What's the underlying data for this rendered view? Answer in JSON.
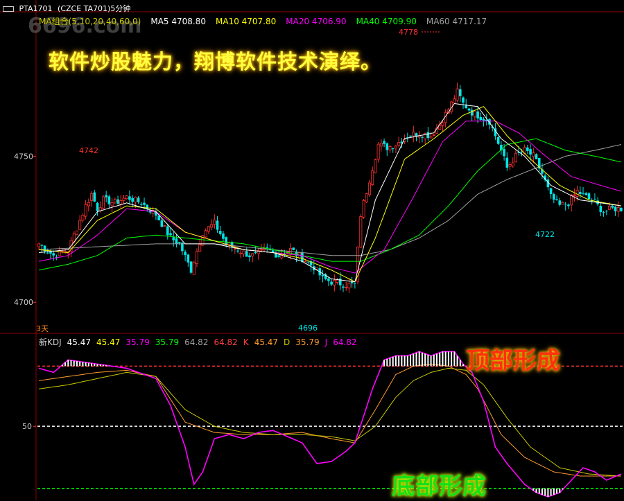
{
  "header": {
    "icon": "window-icon",
    "symbol": "PTA1701",
    "code": "(CZCE TA701)5分钟"
  },
  "watermark": "6696.com",
  "promo_text": "软件炒股魅力，翔博软件技术演绎。",
  "ma_legend": [
    {
      "label": "MA组合(5,10,20,40,60,0)",
      "color": "#c8c800"
    },
    {
      "label": "MA5 4708.80",
      "color": "#ffffff"
    },
    {
      "label": "MA10 4707.80",
      "color": "#ffff00"
    },
    {
      "label": "MA20 4706.90",
      "color": "#ff00ff"
    },
    {
      "label": "MA40 4709.90",
      "color": "#00ff00"
    },
    {
      "label": "MA60 4717.17",
      "color": "#a0a0a0"
    }
  ],
  "period_label": "3天",
  "kdj_legend": [
    {
      "label": "新KDJ",
      "color": "#cccccc"
    },
    {
      "label": "45.47",
      "color": "#ffffff"
    },
    {
      "label": "45.47",
      "color": "#ffff00"
    },
    {
      "label": "35.79",
      "color": "#ff00ff"
    },
    {
      "label": "35.79",
      "color": "#00ff00"
    },
    {
      "label": "64.82",
      "color": "#a0a0a0"
    },
    {
      "label": "64.82",
      "color": "#ff4040"
    },
    {
      "label": "K",
      "color": "#ff4040"
    },
    {
      "label": "45.47",
      "color": "#ff9a30"
    },
    {
      "label": "D",
      "color": "#c8c800"
    },
    {
      "label": "35.79",
      "color": "#ff9a30"
    },
    {
      "label": "J",
      "color": "#ff00ff"
    },
    {
      "label": "64.82",
      "color": "#ff00ff"
    }
  ],
  "annotations": {
    "top_formation": "顶部形成",
    "bottom_formation": "底部形成",
    "high_4742": "4742",
    "high_4778": "4778",
    "low_4696": "4696",
    "low_4722": "4722"
  },
  "chart_data": [
    {
      "type": "candlestick",
      "title": "PTA1701 (CZCE TA701)5分钟",
      "y_ticks": [
        4700,
        4750
      ],
      "ylim": [
        4689.6,
        4799.2
      ],
      "grid": false,
      "colors": {
        "up": "#ff3030",
        "down": "#00e5e5",
        "ma5": "#ffffff",
        "ma10": "#ffff00",
        "ma20": "#ff00ff",
        "ma40": "#00ff00",
        "ma60": "#a0a0a0"
      },
      "extremes": {
        "high": 4778,
        "low": 4696,
        "local_high": 4742,
        "local_low": 4722
      },
      "anchors": [
        [
          0,
          4720
        ],
        [
          5,
          4716
        ],
        [
          10,
          4718
        ],
        [
          14,
          4728
        ],
        [
          16,
          4733
        ],
        [
          18,
          4737
        ],
        [
          20,
          4732
        ],
        [
          22,
          4735
        ],
        [
          26,
          4734
        ],
        [
          30,
          4736
        ],
        [
          35,
          4734
        ],
        [
          40,
          4730
        ],
        [
          45,
          4722
        ],
        [
          48,
          4720
        ],
        [
          52,
          4711
        ],
        [
          56,
          4724
        ],
        [
          60,
          4727
        ],
        [
          64,
          4720
        ],
        [
          68,
          4718
        ],
        [
          72,
          4716
        ],
        [
          74,
          4716
        ],
        [
          78,
          4718
        ],
        [
          82,
          4716
        ],
        [
          86,
          4718
        ],
        [
          90,
          4715
        ],
        [
          94,
          4712
        ],
        [
          97,
          4708
        ],
        [
          100,
          4707
        ],
        [
          105,
          4706
        ],
        [
          108,
          4706
        ],
        [
          110,
          4730
        ],
        [
          113,
          4742
        ],
        [
          116,
          4754
        ],
        [
          119,
          4753
        ],
        [
          122,
          4754
        ],
        [
          126,
          4757
        ],
        [
          130,
          4758
        ],
        [
          134,
          4757
        ],
        [
          137,
          4761
        ],
        [
          140,
          4766
        ],
        [
          143,
          4772
        ],
        [
          145,
          4768
        ],
        [
          148,
          4765
        ],
        [
          150,
          4764
        ],
        [
          154,
          4762
        ],
        [
          158,
          4752
        ],
        [
          160,
          4746
        ],
        [
          163,
          4750
        ],
        [
          166,
          4752
        ],
        [
          169,
          4750
        ],
        [
          172,
          4744
        ],
        [
          175,
          4736
        ],
        [
          178,
          4733
        ],
        [
          181,
          4734
        ],
        [
          184,
          4738
        ],
        [
          187,
          4736
        ],
        [
          190,
          4734
        ],
        [
          193,
          4731
        ],
        [
          196,
          4732
        ],
        [
          199,
          4732
        ]
      ],
      "moving_averages": {
        "ma5": [
          [
            0,
            4717
          ],
          [
            10,
            4718
          ],
          [
            20,
            4731
          ],
          [
            30,
            4734
          ],
          [
            40,
            4731
          ],
          [
            50,
            4720
          ],
          [
            60,
            4720
          ],
          [
            70,
            4718
          ],
          [
            80,
            4717
          ],
          [
            90,
            4714
          ],
          [
            100,
            4708
          ],
          [
            108,
            4707
          ],
          [
            115,
            4735
          ],
          [
            125,
            4756
          ],
          [
            135,
            4758
          ],
          [
            142,
            4768
          ],
          [
            150,
            4767
          ],
          [
            158,
            4756
          ],
          [
            166,
            4750
          ],
          [
            175,
            4740
          ],
          [
            185,
            4735
          ],
          [
            199,
            4733
          ]
        ],
        "ma10": [
          [
            0,
            4718
          ],
          [
            10,
            4717
          ],
          [
            20,
            4728
          ],
          [
            30,
            4733
          ],
          [
            40,
            4732
          ],
          [
            50,
            4724
          ],
          [
            60,
            4721
          ],
          [
            70,
            4718
          ],
          [
            80,
            4717
          ],
          [
            90,
            4715
          ],
          [
            100,
            4711
          ],
          [
            108,
            4707
          ],
          [
            115,
            4722
          ],
          [
            125,
            4749
          ],
          [
            135,
            4756
          ],
          [
            145,
            4764
          ],
          [
            152,
            4767
          ],
          [
            160,
            4757
          ],
          [
            168,
            4749
          ],
          [
            178,
            4740
          ],
          [
            188,
            4735
          ],
          [
            199,
            4733
          ]
        ],
        "ma20": [
          [
            0,
            4714
          ],
          [
            10,
            4716
          ],
          [
            20,
            4723
          ],
          [
            30,
            4732
          ],
          [
            40,
            4731
          ],
          [
            50,
            4724
          ],
          [
            60,
            4721
          ],
          [
            70,
            4718
          ],
          [
            80,
            4717
          ],
          [
            90,
            4716
          ],
          [
            100,
            4712
          ],
          [
            108,
            4710
          ],
          [
            118,
            4718
          ],
          [
            128,
            4736
          ],
          [
            138,
            4755
          ],
          [
            146,
            4762
          ],
          [
            156,
            4762
          ],
          [
            164,
            4758
          ],
          [
            172,
            4751
          ],
          [
            182,
            4743
          ],
          [
            192,
            4740
          ],
          [
            199,
            4738
          ]
        ],
        "ma40": [
          [
            0,
            4711
          ],
          [
            10,
            4713
          ],
          [
            20,
            4716
          ],
          [
            30,
            4722
          ],
          [
            40,
            4723
          ],
          [
            50,
            4722
          ],
          [
            60,
            4721
          ],
          [
            70,
            4720
          ],
          [
            80,
            4718
          ],
          [
            90,
            4716
          ],
          [
            100,
            4714
          ],
          [
            110,
            4714
          ],
          [
            120,
            4718
          ],
          [
            130,
            4723
          ],
          [
            140,
            4733
          ],
          [
            150,
            4745
          ],
          [
            160,
            4754
          ],
          [
            170,
            4756
          ],
          [
            180,
            4752
          ],
          [
            190,
            4750
          ],
          [
            199,
            4748
          ]
        ],
        "ma60": [
          [
            0,
            4718
          ],
          [
            20,
            4719
          ],
          [
            40,
            4720
          ],
          [
            60,
            4720
          ],
          [
            80,
            4718
          ],
          [
            100,
            4716
          ],
          [
            110,
            4716
          ],
          [
            120,
            4718
          ],
          [
            130,
            4722
          ],
          [
            140,
            4728
          ],
          [
            150,
            4737
          ],
          [
            160,
            4742
          ],
          [
            170,
            4746
          ],
          [
            180,
            4750
          ],
          [
            190,
            4752
          ],
          [
            199,
            4754
          ]
        ]
      }
    },
    {
      "type": "line",
      "title": "新KDJ",
      "y_ticks": [
        50
      ],
      "reference_lines": [
        {
          "value": 79,
          "color": "#ff3030"
        },
        {
          "value": 50,
          "color": "#ffffff"
        },
        {
          "value": 20,
          "color": "#00ff00"
        }
      ],
      "ylim": [
        14.3,
        94.5
      ],
      "series": [
        {
          "name": "K",
          "color": "#ff9a30",
          "values": [
            [
              0,
              72
            ],
            [
              10,
              74
            ],
            [
              20,
              76
            ],
            [
              30,
              77
            ],
            [
              40,
              74
            ],
            [
              50,
              52
            ],
            [
              60,
              47
            ],
            [
              70,
              46
            ],
            [
              80,
              46
            ],
            [
              90,
              47
            ],
            [
              100,
              44
            ],
            [
              108,
              42
            ],
            [
              115,
              58
            ],
            [
              122,
              75
            ],
            [
              128,
              79
            ],
            [
              134,
              80
            ],
            [
              140,
              79
            ],
            [
              146,
              75
            ],
            [
              150,
              68
            ],
            [
              158,
              46
            ],
            [
              166,
              35
            ],
            [
              176,
              28
            ],
            [
              185,
              26
            ],
            [
              199,
              26
            ]
          ]
        },
        {
          "name": "D",
          "color": "#c8c800",
          "values": [
            [
              0,
              68
            ],
            [
              10,
              70
            ],
            [
              20,
              73
            ],
            [
              30,
              76
            ],
            [
              40,
              74
            ],
            [
              50,
              58
            ],
            [
              60,
              50
            ],
            [
              70,
              47
            ],
            [
              80,
              46
            ],
            [
              90,
              46
            ],
            [
              100,
              45
            ],
            [
              108,
              43
            ],
            [
              115,
              50
            ],
            [
              122,
              64
            ],
            [
              128,
              72
            ],
            [
              134,
              76
            ],
            [
              140,
              78
            ],
            [
              146,
              77
            ],
            [
              152,
              70
            ],
            [
              160,
              54
            ],
            [
              168,
              40
            ],
            [
              178,
              30
            ],
            [
              188,
              27
            ],
            [
              199,
              26
            ]
          ]
        },
        {
          "name": "J",
          "color": "#ff00ff",
          "values": [
            [
              0,
              78
            ],
            [
              5,
              76
            ],
            [
              10,
              82
            ],
            [
              20,
              80
            ],
            [
              30,
              78
            ],
            [
              40,
              73
            ],
            [
              45,
              60
            ],
            [
              50,
              40
            ],
            [
              53,
              22
            ],
            [
              56,
              28
            ],
            [
              60,
              44
            ],
            [
              65,
              46
            ],
            [
              70,
              44
            ],
            [
              75,
              47
            ],
            [
              80,
              48
            ],
            [
              85,
              45
            ],
            [
              90,
              42
            ],
            [
              95,
              32
            ],
            [
              100,
              33
            ],
            [
              105,
              38
            ],
            [
              108,
              42
            ],
            [
              114,
              68
            ],
            [
              118,
              82
            ],
            [
              122,
              84
            ],
            [
              126,
              84
            ],
            [
              130,
              86
            ],
            [
              134,
              84
            ],
            [
              138,
              86
            ],
            [
              142,
              86
            ],
            [
              145,
              80
            ],
            [
              148,
              76
            ],
            [
              152,
              62
            ],
            [
              156,
              40
            ],
            [
              160,
              32
            ],
            [
              166,
              22
            ],
            [
              170,
              18
            ],
            [
              174,
              16
            ],
            [
              178,
              18
            ],
            [
              182,
              24
            ],
            [
              186,
              30
            ],
            [
              190,
              28
            ],
            [
              194,
              24
            ],
            [
              199,
              27
            ]
          ]
        }
      ]
    }
  ]
}
